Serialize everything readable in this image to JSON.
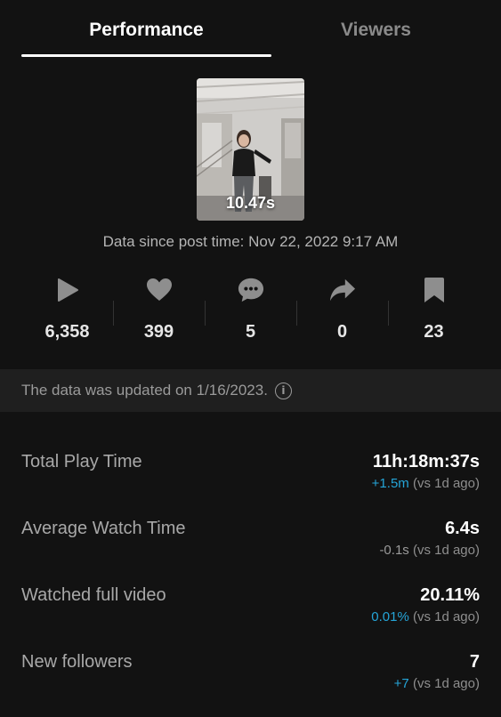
{
  "tabs": [
    {
      "label": "Performance",
      "active": true
    },
    {
      "label": "Viewers",
      "active": false
    }
  ],
  "video": {
    "duration": "10.47s",
    "post_time_text": "Data since post time: Nov 22, 2022 9:17 AM"
  },
  "stats": [
    {
      "icon": "play-icon",
      "value": "6,358"
    },
    {
      "icon": "heart-icon",
      "value": "399"
    },
    {
      "icon": "comment-icon",
      "value": "5"
    },
    {
      "icon": "share-icon",
      "value": "0"
    },
    {
      "icon": "bookmark-icon",
      "value": "23"
    }
  ],
  "update_notice": "The data was updated on 1/16/2023.",
  "info_icon_glyph": "i",
  "metrics": [
    {
      "label": "Total Play Time",
      "value": "11h:18m:37s",
      "delta": "+1.5m",
      "suffix": "(vs 1d ago)",
      "delta_color": "#25a5d8"
    },
    {
      "label": "Average Watch Time",
      "value": "6.4s",
      "delta": "-0.1s",
      "suffix": "(vs 1d ago)",
      "delta_color": "#9a9a9a"
    },
    {
      "label": "Watched full video",
      "value": "20.11%",
      "delta": "0.01%",
      "suffix": "(vs 1d ago)",
      "delta_color": "#25a5d8"
    },
    {
      "label": "New followers",
      "value": "7",
      "delta": "+7",
      "suffix": "(vs 1d ago)",
      "delta_color": "#25a5d8"
    }
  ],
  "colors": {
    "background": "#121212",
    "positive": "#25a5d8",
    "muted": "#9a9a9a"
  }
}
